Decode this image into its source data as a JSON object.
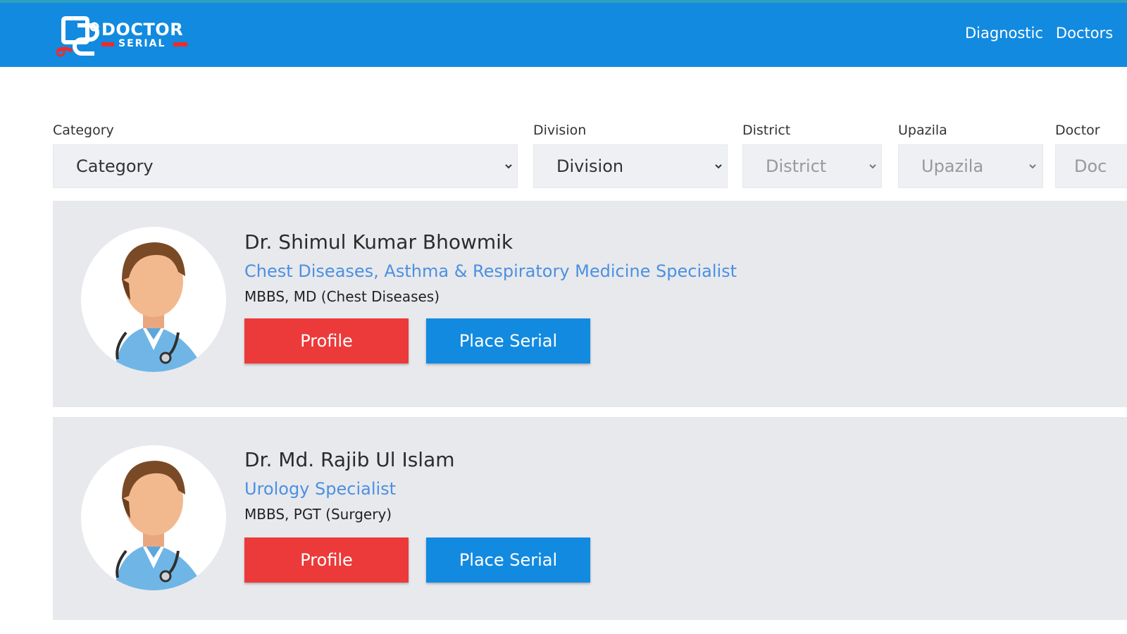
{
  "colors": {
    "header": "#128ae0",
    "profile_button": "#ec3a3a",
    "serial_button": "#128ae0",
    "specialty_text": "#4b90e2",
    "card_bg": "#e8e9ec"
  },
  "brand": {
    "logo_mark": "DS",
    "name_line1": "DOCTOR",
    "name_line2": "SERIAL"
  },
  "nav": {
    "items": [
      {
        "label": "Diagnostic"
      },
      {
        "label": "Doctors"
      }
    ]
  },
  "filters": {
    "category": {
      "label": "Category",
      "value": "Category",
      "icon": "chevron-down-icon"
    },
    "division": {
      "label": "Division",
      "value": "Division",
      "icon": "chevron-down-icon"
    },
    "district": {
      "label": "District",
      "value": "District",
      "icon": "chevron-down-icon"
    },
    "upazila": {
      "label": "Upazila",
      "value": "Upazila",
      "icon": "chevron-down-icon"
    },
    "doctor": {
      "label": "Doctor",
      "value": "Doc"
    }
  },
  "doctors": [
    {
      "name": "Dr. Shimul Kumar Bhowmik",
      "specialty": "Chest Diseases, Asthma & Respiratory Medicine Specialist",
      "degrees": "MBBS, MD (Chest Diseases)",
      "profile_label": "Profile",
      "serial_label": "Place Serial",
      "avatar_icon": "doctor-avatar-icon"
    },
    {
      "name": "Dr. Md. Rajib Ul Islam",
      "specialty": "Urology Specialist",
      "degrees": "MBBS, PGT (Surgery)",
      "profile_label": "Profile",
      "serial_label": "Place Serial",
      "avatar_icon": "doctor-avatar-icon"
    }
  ]
}
